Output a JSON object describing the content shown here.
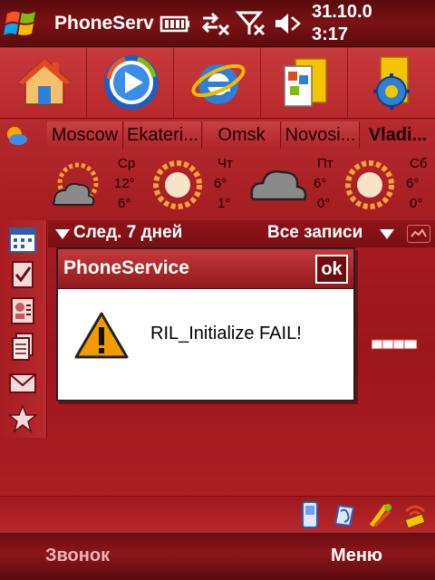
{
  "titlebar": {
    "title": "PhoneServ",
    "date": "31.10.0",
    "time": "3:17",
    "icons": [
      "windows-start-icon",
      "battery-icon",
      "connectivity-off-icon",
      "signal-off-icon",
      "speaker-muted-icon"
    ]
  },
  "launcher": {
    "icons": [
      "home-icon",
      "media-player-icon",
      "internet-explorer-icon",
      "file-explorer-icon",
      "settings-folder-icon"
    ]
  },
  "weather": {
    "cities": [
      "Moscow",
      "Ekateri...",
      "Omsk",
      "Novosi...",
      "Vladi..."
    ],
    "active_city_index": 4,
    "days": [
      {
        "name": "Ср",
        "hi": "12°",
        "lo": "6°",
        "icon": "cloud-sun-icon"
      },
      {
        "name": "Чт",
        "hi": "6°",
        "lo": "1°",
        "icon": "sun-icon"
      },
      {
        "name": "Пт",
        "hi": "6°",
        "lo": "0°",
        "icon": "cloud-icon"
      },
      {
        "name": "Сб",
        "hi": "6°",
        "lo": "0°",
        "icon": "sun-icon"
      }
    ]
  },
  "calendar": {
    "range_label": "След. 7 дней",
    "filter_label": "Все записи"
  },
  "sidebar": {
    "icons": [
      "calendar-icon",
      "tasks-icon",
      "contacts-icon",
      "notes-icon",
      "mail-icon",
      "favorites-icon"
    ]
  },
  "tray": {
    "icons": [
      "phone-icon",
      "sync-icon",
      "tools-icon",
      "wireless-icon"
    ]
  },
  "softkeys": {
    "left": "Звонок",
    "right": "Меню"
  },
  "dialog": {
    "title": "PhoneService",
    "ok_label": "ok",
    "message": "RIL_Initialize FAIL!"
  },
  "colors": {
    "accent": "#a81c22",
    "dark": "#5a0a0d",
    "dialog_bg": "#ffffff",
    "warning": "#f29a00"
  }
}
